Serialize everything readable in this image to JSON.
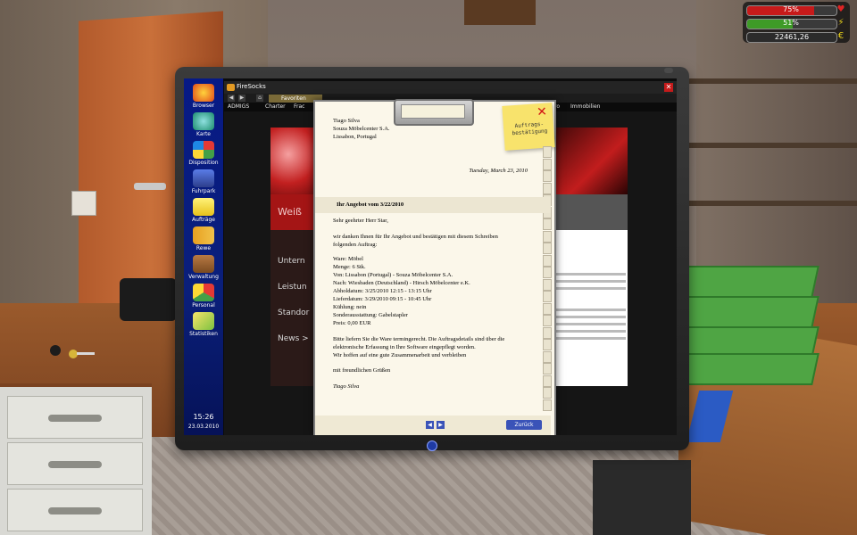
{
  "hud": {
    "health": {
      "label": "75%",
      "fill": 0.75,
      "color": "#c71a1a"
    },
    "energy": {
      "label": "51%",
      "fill": 0.51,
      "color": "#3e9b27"
    },
    "money": {
      "label": "22461,26",
      "currency": "€"
    }
  },
  "os": {
    "apps": [
      {
        "label": "Browser",
        "icon": "browser-icon"
      },
      {
        "label": "Karte",
        "icon": "map-icon"
      },
      {
        "label": "Disposition",
        "icon": "disposition-icon"
      },
      {
        "label": "Fuhrpark",
        "icon": "truck-icon"
      },
      {
        "label": "Aufträge",
        "icon": "folder-icon"
      },
      {
        "label": "Rewe",
        "icon": "rewe-icon"
      },
      {
        "label": "Verwaltung",
        "icon": "briefcase-icon"
      },
      {
        "label": "Personal",
        "icon": "people-icon"
      },
      {
        "label": "Statistiken",
        "icon": "chart-icon"
      }
    ],
    "time": "15:26",
    "date": "23.03.2010"
  },
  "browser": {
    "title": "FireSocks",
    "favorites_tab": "Favoriten",
    "bookmarks": [
      "ADMIGS",
      "Charter",
      "Frac",
      "ro",
      "Immobilien"
    ],
    "page": {
      "brand_partial": "Weiß",
      "menu": [
        "Untern",
        "Leistun",
        "Standor",
        "News >"
      ]
    }
  },
  "letter": {
    "sticky_label": "Auftrags-\nbestätigung",
    "sender_lines": [
      "Tiago Silva",
      "Souza Möbelcenter S.A.",
      "Lissabon, Portugal"
    ],
    "date": "Tuesday, March 23, 2010",
    "subject": "Ihr Angebot vom 3/22/2010",
    "greeting": "Sehr geehrter Herr Star,",
    "intro_lines": [
      "wir danken Ihnen für Ihr Angebot und bestätigen mit diesem Schreiben",
      "folgenden Auftrag:"
    ],
    "details": [
      "Ware: Möbel",
      "Menge: 6 Stk.",
      "Von: Lissabon (Portugal) - Souza Möbelcenter S.A.",
      "Nach: Wiesbaden (Deutschland) - Hirsch Möbelcenter e.K.",
      "Abholdatum: 3/25/2010 12:15 - 13:15 Uhr",
      "Lieferdatum: 3/29/2010 09:15 - 10:45 Uhr",
      "Kühlung: nein",
      "Sonderausstattung: Gabelstapler",
      "Preis: 0,00 EUR"
    ],
    "closing_lines": [
      "Bitte liefern Sie die Ware termingerecht. Die Auftragsdetails sind über die",
      "elektronische Erfassung in Ihre Software eingepflegt worden.",
      "Wir hoffen auf eine gute Zusammenarbeit und verbleiben"
    ],
    "regards": "mit freundlichen Grüßen",
    "signature": "Tiago Silva",
    "back_button": "Zurück"
  }
}
